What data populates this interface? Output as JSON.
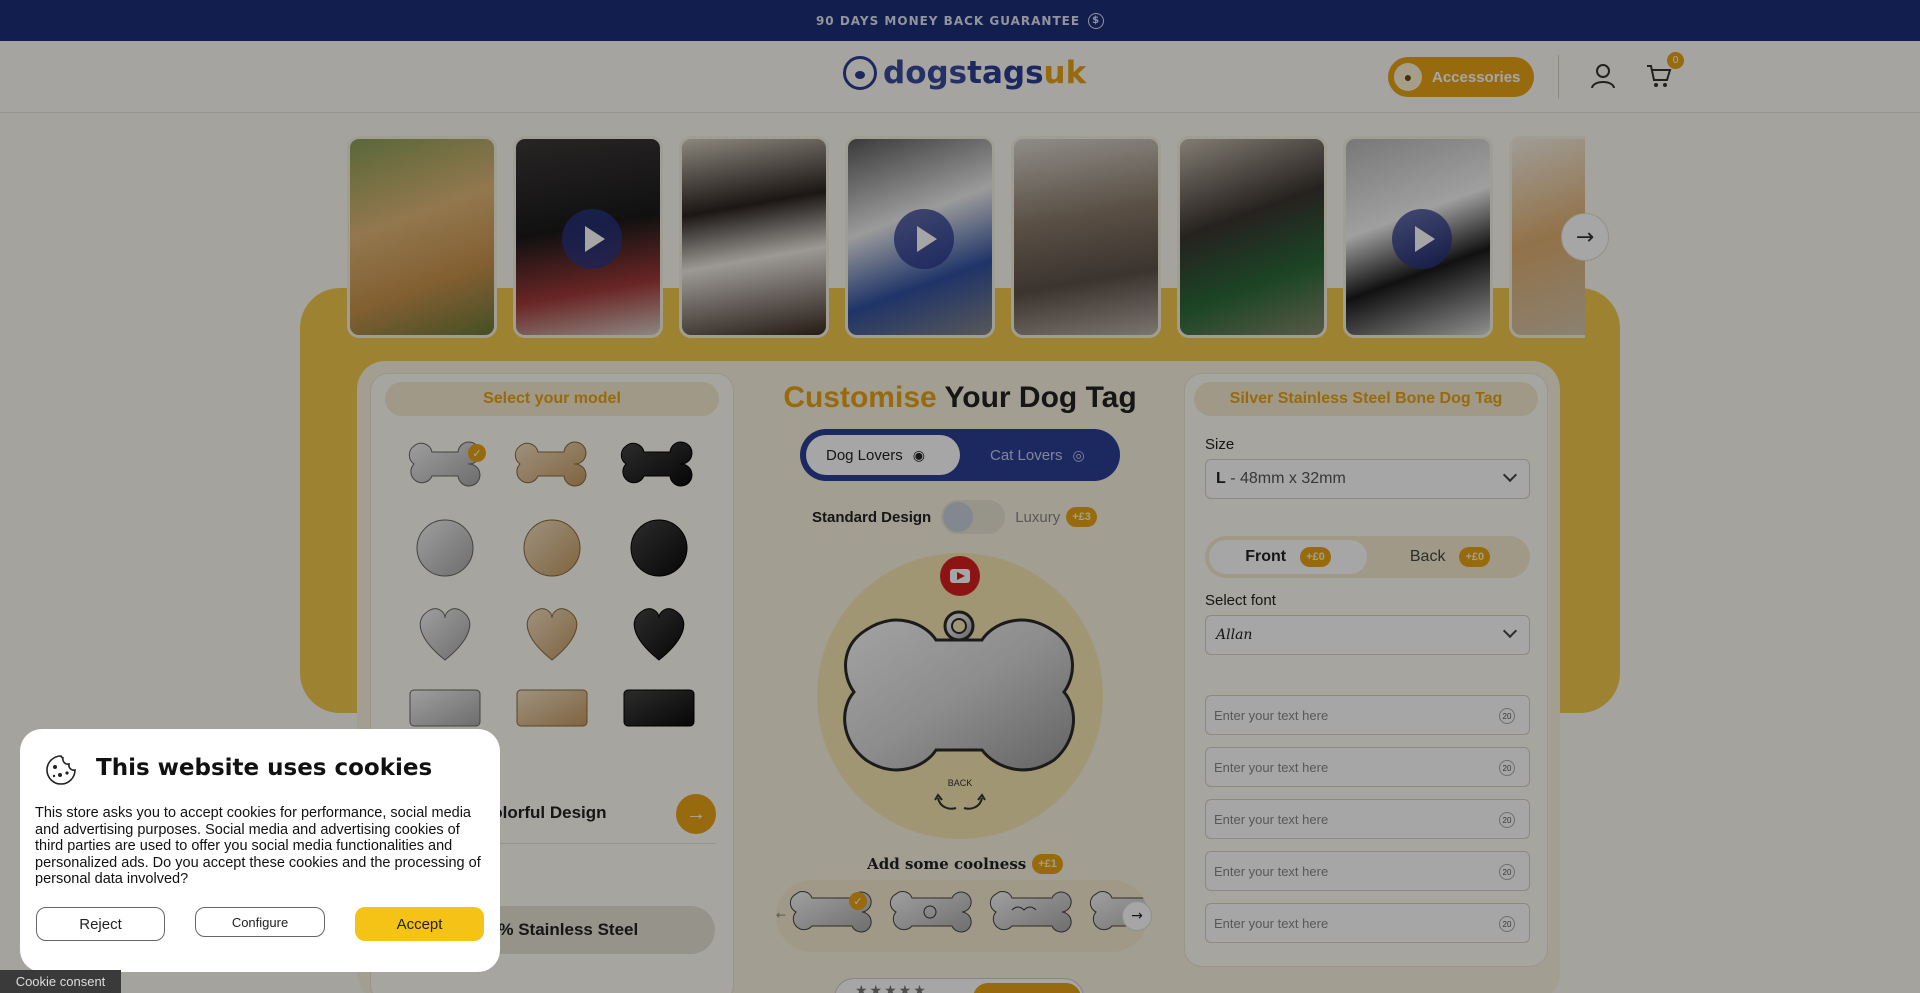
{
  "banner": {
    "text": "90 DAYS MONEY BACK GUARANTEE",
    "icon": "dollar-coin-icon"
  },
  "header": {
    "logo": {
      "part1": "dogs",
      "part2": "tags",
      "part3": "uk"
    },
    "accessories_label": "Accessories",
    "cart_count": "0"
  },
  "gallery": {
    "items": [
      {
        "subject": "cocker spaniel with red collar",
        "video": false
      },
      {
        "subject": "dog with blue collar",
        "video": true
      },
      {
        "subject": "cavalier king charles spaniel",
        "video": false
      },
      {
        "subject": "husky with blue collar",
        "video": true
      },
      {
        "subject": "tabby cat with tag",
        "video": false
      },
      {
        "subject": "brindle dog with green collar",
        "video": false
      },
      {
        "subject": "white dog with collar",
        "video": true
      },
      {
        "subject": "labrador",
        "video": false
      }
    ]
  },
  "model_panel": {
    "title": "Select your model",
    "option1_label": "Colorful Design",
    "option2_label": "100% Stainless Steel"
  },
  "center": {
    "title_highlight": "Customise",
    "title_rest": " Your Dog Tag",
    "dog_lovers_label": "Dog Lovers",
    "cat_lovers_label": "Cat Lovers",
    "standard_label": "Standard Design",
    "luxury_label": "Luxury",
    "luxury_price": "+£3",
    "back_label": "BACK",
    "coolness_label": "Add some coolness",
    "coolness_price": "+£1"
  },
  "details": {
    "title": "Silver Stainless Steel Bone Dog Tag",
    "size_label": "Size",
    "size_code": "L",
    "size_value": " - 48mm x 32mm",
    "front_label": "Front",
    "front_price": "+£0",
    "back_label": "Back",
    "back_price": "+£0",
    "font_label": "Select font",
    "font_value": "Allan",
    "text_placeholder": "Enter your text here",
    "char_limit": "20"
  },
  "cookie": {
    "title": "This website uses cookies",
    "body": "This store asks you to accept cookies for performance, social media and advertising purposes. Social media and advertising cookies of third parties are used to offer you social media functionalities and personalized ads. Do you accept these cookies and the processing of personal data involved?",
    "reject_label": "Reject",
    "configure_label": "Configure",
    "accept_label": "Accept",
    "consent_tab_label": "Cookie consent"
  },
  "colors": {
    "brand_blue": "#2c3e94",
    "accent_gold": "#e8a316",
    "banner_bg": "#1d2e78"
  }
}
